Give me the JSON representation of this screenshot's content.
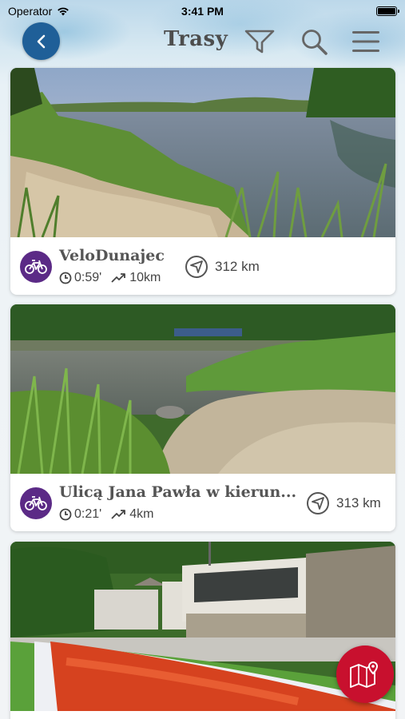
{
  "status_bar": {
    "carrier": "Operator",
    "time": "3:41 PM",
    "battery_level": 1.0
  },
  "nav": {
    "title": "Trasy",
    "icons": [
      "chevron-left-icon",
      "filter-icon",
      "search-icon",
      "menu-icon"
    ]
  },
  "routes": [
    {
      "name": "VeloDunajec",
      "duration": "0:59'",
      "length": "10km",
      "distance": "312 km",
      "type_icon": "bicycle-icon"
    },
    {
      "name": "Ulicą Jana Pawła w kierun...",
      "duration": "0:21'",
      "length": "4km",
      "distance": "313 km",
      "type_icon": "bicycle-icon"
    }
  ],
  "fab": {
    "icon": "map-pin-icon"
  },
  "colors": {
    "back_button": "#1f5f98",
    "bike_badge": "#5b2a86",
    "map_fab": "#c8102e",
    "title_text": "#4d4d4d"
  }
}
